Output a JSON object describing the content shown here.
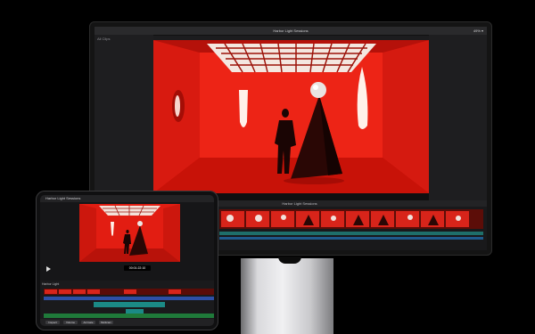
{
  "monitor": {
    "app_title": "Harbor Light Sessions",
    "zoom": "49% ▾",
    "browser_label": "All Clips",
    "timeline_title": "Harbor Light Sessions"
  },
  "ipad": {
    "project_title": "Harbor Light Sessions",
    "library_label": "Harbor Light",
    "timecode": "00:01:22:10",
    "bottom_buttons": [
      "Inspect",
      "Volume",
      "Animate",
      "Multicam"
    ]
  },
  "colors": {
    "room_red": "#e41d12",
    "audio_teal": "#1b8a86",
    "audio_blue": "#2d4fa6",
    "music_green": "#1f7a3a"
  },
  "icons": [
    "play-icon",
    "light-ceiling-icon"
  ]
}
